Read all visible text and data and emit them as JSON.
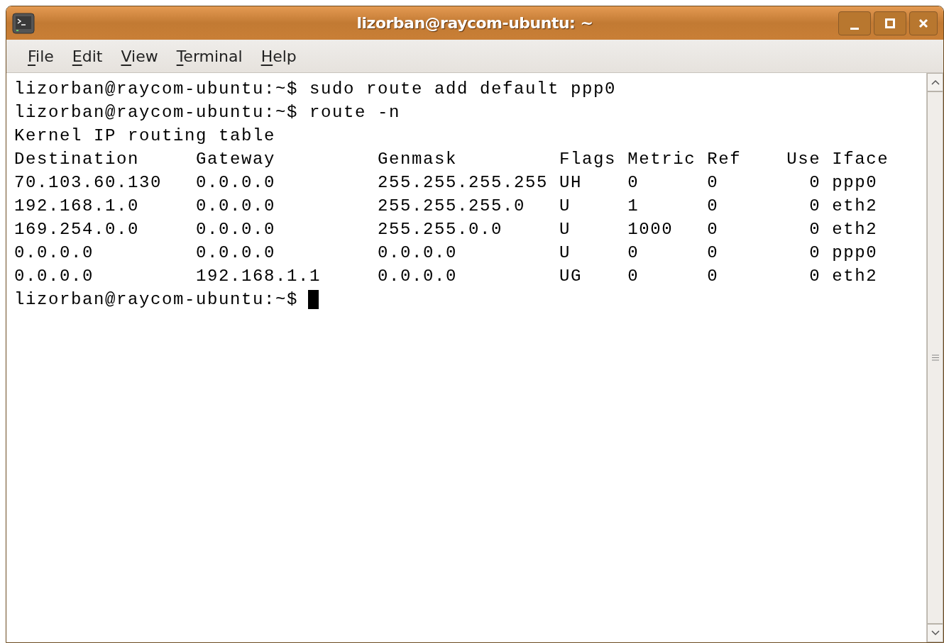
{
  "window": {
    "title": "lizorban@raycom-ubuntu: ~"
  },
  "menu": [
    "File",
    "Edit",
    "View",
    "Terminal",
    "Help"
  ],
  "terminal": {
    "lines": [
      "lizorban@raycom-ubuntu:~$ sudo route add default ppp0",
      "lizorban@raycom-ubuntu:~$ route -n",
      "Kernel IP routing table",
      "Destination     Gateway         Genmask         Flags Metric Ref    Use Iface",
      "70.103.60.130   0.0.0.0         255.255.255.255 UH    0      0        0 ppp0",
      "192.168.1.0     0.0.0.0         255.255.255.0   U     1      0        0 eth2",
      "169.254.0.0     0.0.0.0         255.255.0.0     U     1000   0        0 eth2",
      "0.0.0.0         0.0.0.0         0.0.0.0         U     0      0        0 ppp0",
      "0.0.0.0         192.168.1.1     0.0.0.0         UG    0      0        0 eth2"
    ],
    "prompt": "lizorban@raycom-ubuntu:~$"
  }
}
